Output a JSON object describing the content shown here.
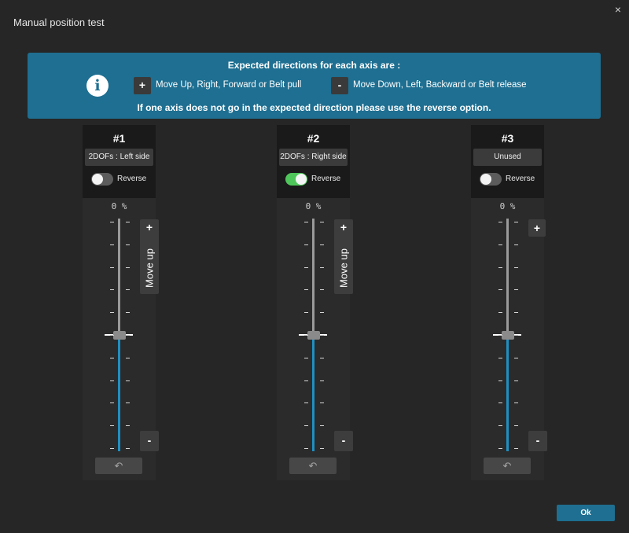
{
  "window": {
    "title": "Manual position test",
    "close_glyph": "×"
  },
  "banner": {
    "header": "Expected directions for each axis are :",
    "footer": "If one axis does not go in the expected direction please use the reverse option.",
    "info_glyph": "i",
    "plus_glyph": "+",
    "plus_text": "Move Up, Right, Forward or Belt pull",
    "minus_glyph": "-",
    "minus_text": "Move Down, Left, Backward or Belt release",
    "color": "#1e6f91"
  },
  "axes": [
    {
      "number": "#1",
      "name": "2DOFs : Left side",
      "reverse_label": "Reverse",
      "reverse_on": false,
      "percent": "0 %",
      "position_fraction": 0.5,
      "plus_glyph": "+",
      "move_label": "Move up",
      "minus_glyph": "-",
      "reset_glyph": "↶"
    },
    {
      "number": "#2",
      "name": "2DOFs : Right side",
      "reverse_label": "Reverse",
      "reverse_on": true,
      "percent": "0 %",
      "position_fraction": 0.5,
      "plus_glyph": "+",
      "move_label": "Move up",
      "minus_glyph": "-",
      "reset_glyph": "↶"
    },
    {
      "number": "#3",
      "name": "Unused",
      "reverse_label": "Reverse",
      "reverse_on": false,
      "percent": "0 %",
      "position_fraction": 0.5,
      "plus_glyph": "+",
      "minus_glyph": "-",
      "reset_glyph": "↶"
    }
  ],
  "colors": {
    "fill": "#1f8fc2",
    "toggle_on": "#4fc65a",
    "toggle_off": "#5c5c5c"
  },
  "ok_button": {
    "label": "Ok"
  }
}
